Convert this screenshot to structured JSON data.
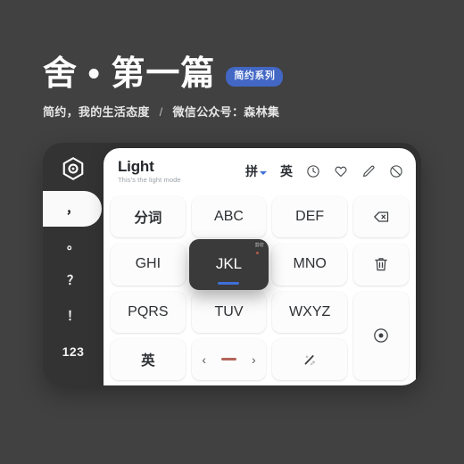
{
  "page": {
    "background_color": "#414141"
  },
  "header": {
    "title": "舍 • 第一篇",
    "badge": "简约系列",
    "subtitle_left": "简约，我的生活态度",
    "subtitle_sep": "/",
    "subtitle_right": "微信公众号：森林集",
    "badge_color": "#4267c4"
  },
  "card": {
    "background_color": "#333333",
    "logo_icon": "hexagon-dot-icon"
  },
  "keyboard": {
    "panel_color": "#ffffff",
    "head": {
      "mode_name": "Light",
      "mode_sub": "This's the light mode",
      "tools": [
        {
          "name": "pinyin-toggle",
          "label": "拼",
          "icon": "chevron-down-icon",
          "has_caret": true
        },
        {
          "name": "english-toggle",
          "label": "英",
          "icon": "",
          "has_caret": false
        },
        {
          "name": "recent-button",
          "label": "",
          "icon": "clock-icon",
          "has_caret": false
        },
        {
          "name": "favorites-button",
          "label": "",
          "icon": "heart-icon",
          "has_caret": false
        },
        {
          "name": "edit-button",
          "label": "",
          "icon": "pencil-icon",
          "has_caret": false
        },
        {
          "name": "block-button",
          "label": "",
          "icon": "no-entry-icon",
          "has_caret": false
        }
      ]
    },
    "rail": [
      {
        "label": "，",
        "name": "comma-key",
        "active": true
      },
      {
        "label": "。",
        "name": "period-key",
        "active": false
      },
      {
        "label": "？",
        "name": "question-key",
        "active": false
      },
      {
        "label": "！",
        "name": "exclaim-key",
        "active": false
      },
      {
        "label": "123",
        "name": "numbers-key",
        "active": false
      }
    ],
    "grid": [
      {
        "label": "分词",
        "name": "segment-key",
        "type": "cn"
      },
      {
        "label": "ABC",
        "name": "abc-key",
        "type": "latin"
      },
      {
        "label": "DEF",
        "name": "def-key",
        "type": "latin"
      },
      {
        "label": "",
        "name": "backspace-key",
        "type": "icon",
        "icon": "backspace-icon"
      },
      {
        "label": "GHI",
        "name": "ghi-key",
        "type": "latin"
      },
      {
        "label": "JKL",
        "name": "jkl-key",
        "type": "latin"
      },
      {
        "label": "MNO",
        "name": "mno-key",
        "type": "latin"
      },
      {
        "label": "",
        "name": "clear-key",
        "type": "icon",
        "icon": "trash-icon"
      },
      {
        "label": "PQRS",
        "name": "pqrs-key",
        "type": "latin"
      },
      {
        "label": "TUV",
        "name": "tuv-key",
        "type": "latin"
      },
      {
        "label": "WXYZ",
        "name": "wxyz-key",
        "type": "latin"
      },
      {
        "label": "",
        "name": "enter-key",
        "type": "icon-tall",
        "icon": "target-circle-icon"
      },
      {
        "label": "英",
        "name": "english-key",
        "type": "cn"
      },
      {
        "label": "",
        "name": "space-nav-key",
        "type": "nav"
      },
      {
        "label": "",
        "name": "magic-key",
        "type": "icon",
        "icon": "magic-wand-icon"
      }
    ],
    "pressed_key": {
      "label": "JKL",
      "badge": "剪切",
      "accent_color": "#3f6fd8",
      "background_color": "#3a3a3a"
    },
    "nav_key": {
      "prev": "‹",
      "next": "›",
      "dash_color": "#b4645a"
    }
  }
}
